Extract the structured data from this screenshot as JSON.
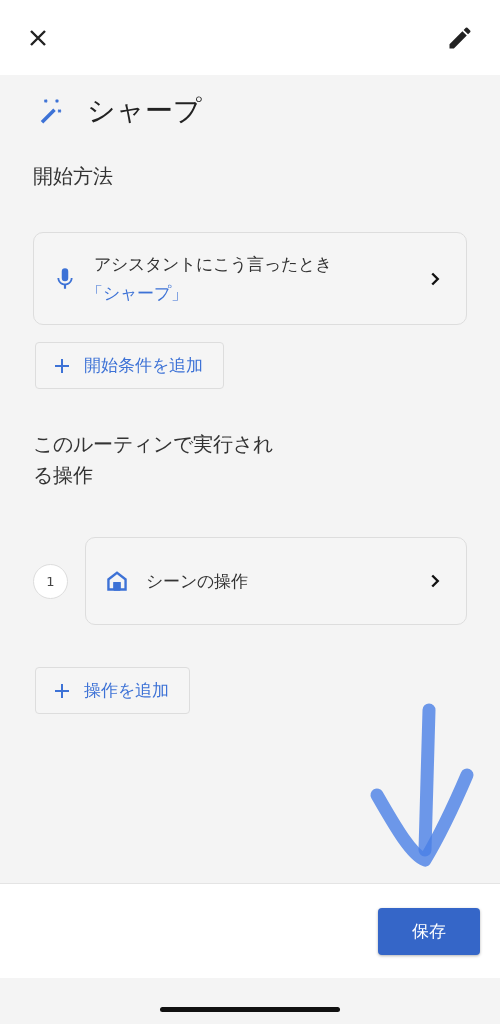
{
  "routine": {
    "title": "シャープ"
  },
  "starters": {
    "heading": "開始方法",
    "items": [
      {
        "kind": "voice",
        "label": "アシスタントにこう言ったとき",
        "phrase": "「シャープ」"
      }
    ],
    "add_button": "開始条件を追加"
  },
  "actions": {
    "heading": "このルーティンで実行される操作",
    "items": [
      {
        "kind": "scene",
        "number": "1",
        "label": "シーンの操作"
      }
    ],
    "add_button": "操作を追加"
  },
  "footer": {
    "save_button": "保存"
  }
}
